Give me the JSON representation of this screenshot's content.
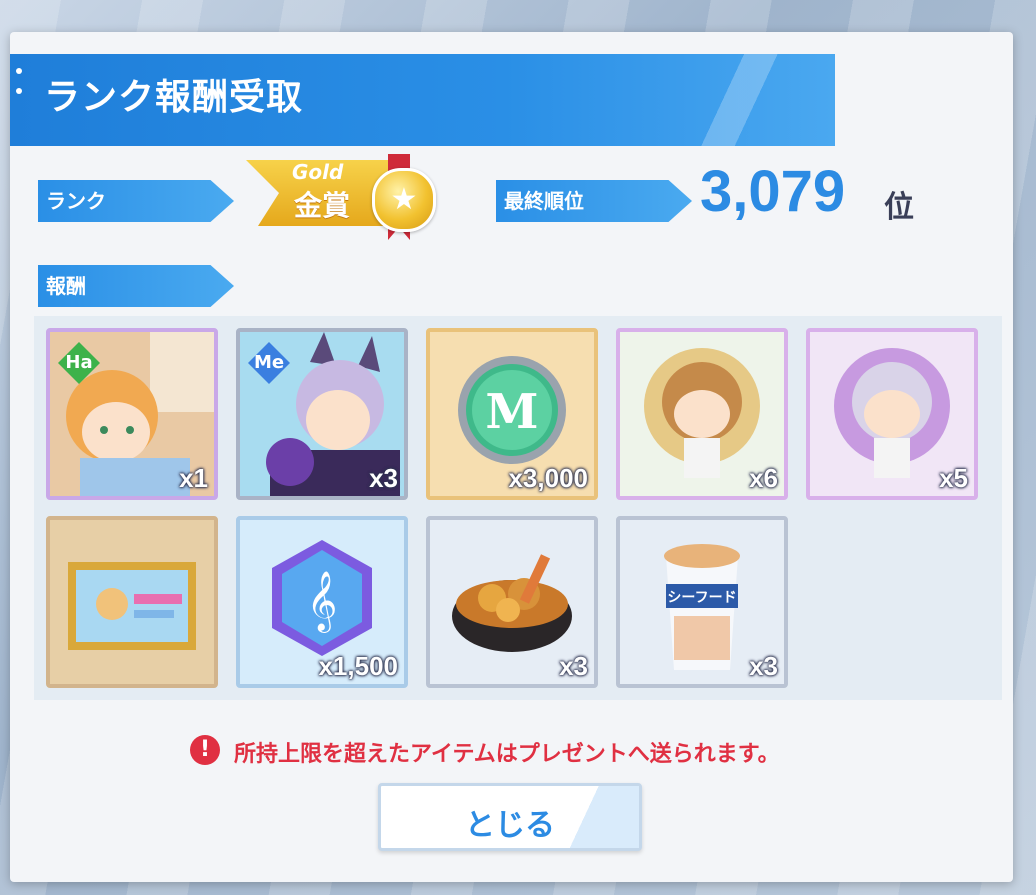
{
  "dialog": {
    "title": "ランク報酬受取",
    "rank_label": "ランク",
    "reward_label": "報酬",
    "final_rank_label": "最終順位",
    "final_rank_value": "3,079",
    "final_rank_unit": "位",
    "award": {
      "word": "Gold",
      "jp": "金賞",
      "medal_icon": "star-icon"
    }
  },
  "items": [
    {
      "name": "card-ha",
      "attr": "Ha",
      "attr_color": "#3db24a",
      "qty": "x1",
      "frame": "#c9a8e8"
    },
    {
      "name": "card-me",
      "attr": "Me",
      "attr_color": "#3a7fe0",
      "qty": "x3",
      "frame": "#a9b3c6"
    },
    {
      "name": "music-coin",
      "attr": "",
      "attr_color": "",
      "qty": "x3,000",
      "frame": "#e9c27a"
    },
    {
      "name": "chibi-blond",
      "attr": "",
      "attr_color": "",
      "qty": "x6",
      "frame": "#d8b0ea"
    },
    {
      "name": "chibi-silver",
      "attr": "",
      "attr_color": "",
      "qty": "x5",
      "frame": "#d8b0ea"
    },
    {
      "name": "picture-frame",
      "attr": "",
      "attr_color": "",
      "qty": "",
      "frame": "#d2b48c"
    },
    {
      "name": "treble-crystal",
      "attr": "",
      "attr_color": "",
      "qty": "x1,500",
      "frame": "#a9cbe8"
    },
    {
      "name": "tempura-bowl",
      "attr": "",
      "attr_color": "",
      "qty": "x3",
      "frame": "#b9c3d3"
    },
    {
      "name": "seafood-ramen",
      "attr": "",
      "attr_color": "",
      "qty": "x3",
      "frame": "#b9c3d3",
      "cup_text": "シーフード"
    }
  ],
  "notice": "所持上限を超えたアイテムはプレゼントへ送られます。",
  "close_label": "とじる"
}
